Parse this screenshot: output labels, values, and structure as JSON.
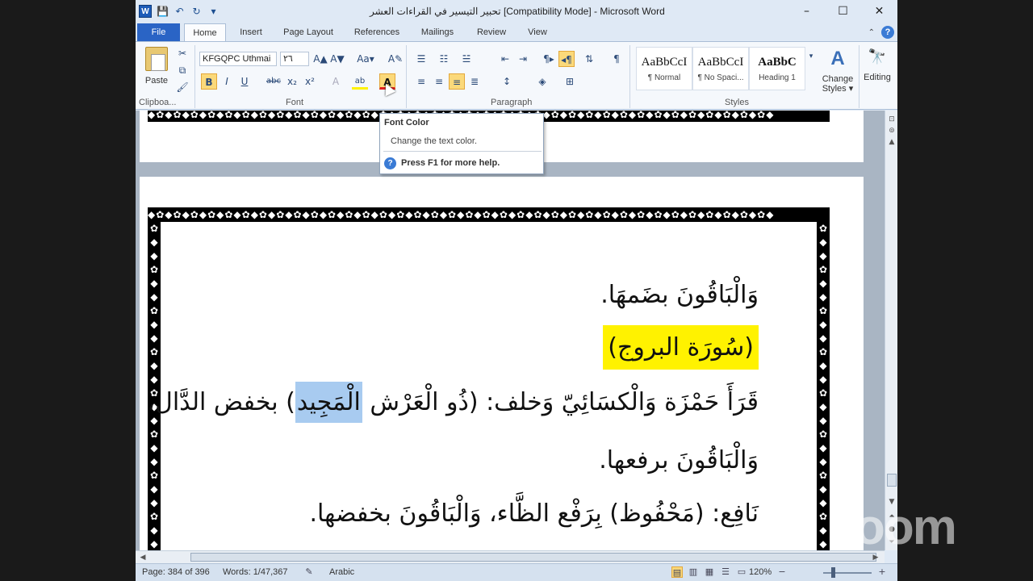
{
  "window": {
    "title": "تحبير التيسير في القراءات العشر [Compatibility Mode] - Microsoft Word",
    "minimize": "–",
    "maximize": "☐",
    "close": "✕"
  },
  "qat": {
    "app_icon": "W",
    "save_icon": "💾",
    "undo_icon": "↶",
    "redo_icon": "↻",
    "customize_icon": "▾"
  },
  "tabs": {
    "file": "File",
    "items": [
      "Home",
      "Insert",
      "Page Layout",
      "References",
      "Mailings",
      "Review",
      "View"
    ]
  },
  "ribbon": {
    "clipboard": {
      "label": "Clipboa...",
      "paste": "Paste"
    },
    "font": {
      "label": "Font",
      "font_name": "KFGQPC Uthmai",
      "font_size": "٢٦",
      "bold": "B",
      "italic": "I",
      "underline": "U",
      "strike": "abc",
      "subscript": "x₂",
      "superscript": "x²",
      "grow": "A▲",
      "shrink": "A▼",
      "change_case": "Aa▾",
      "clear": "A✎",
      "highlight": "ab",
      "font_color": "A"
    },
    "paragraph": {
      "label": "Paragraph"
    },
    "styles": {
      "label": "Styles",
      "items": [
        {
          "sample": "AaBbCcI",
          "name": "¶ Normal"
        },
        {
          "sample": "AaBbCcI",
          "name": "¶ No Spaci..."
        },
        {
          "sample": "AaBbC",
          "name": "Heading 1"
        }
      ],
      "change_styles": "Change Styles ▾"
    },
    "editing": {
      "label": "Editing"
    }
  },
  "tooltip": {
    "title": "Font Color",
    "description": "Change the text color.",
    "help": "Press F1 for more help."
  },
  "document": {
    "border_pattern": "◆✿◆✿◆✿◆✿◆✿◆✿◆✿◆✿◆✿◆✿◆✿◆✿◆✿◆✿◆✿◆✿◆✿◆✿◆✿◆✿◆✿◆✿◆✿◆✿◆✿◆✿◆✿◆✿◆✿◆✿◆✿◆✿◆✿◆✿◆✿◆✿◆",
    "border_v": "✿ ◆ ◆ ✿ ◆ ◆ ✿ ◆ ◆ ✿ ◆ ◆ ✿ ◆ ◆ ✿ ◆ ◆ ✿ ◆ ◆ ✿ ◆ ◆",
    "line1": "وَالْبَاقُونَ بضَمهَا.",
    "line2": "(سُورَة البروج)",
    "line3_a": "قَرَأَ حَمْزَة وَالْكسَائِيّ وَخلف: (ذُو الْعَرْش ",
    "line3_selected": "الْمَجِيد",
    "line3_b": ") بخفض الدَّال،",
    "line4": "وَالْبَاقُونَ برفعها.",
    "line5": "نَافِع: (مَحْفُوظ) بِرَفْع الظَّاء، وَالْبَاقُونَ بخفضها."
  },
  "status": {
    "page": "Page: 384 of 396",
    "words": "Words: 1/47,367",
    "language": "Arabic",
    "zoom": "120%",
    "zoom_minus": "−",
    "zoom_plus": "+"
  },
  "watermark": "zoom"
}
